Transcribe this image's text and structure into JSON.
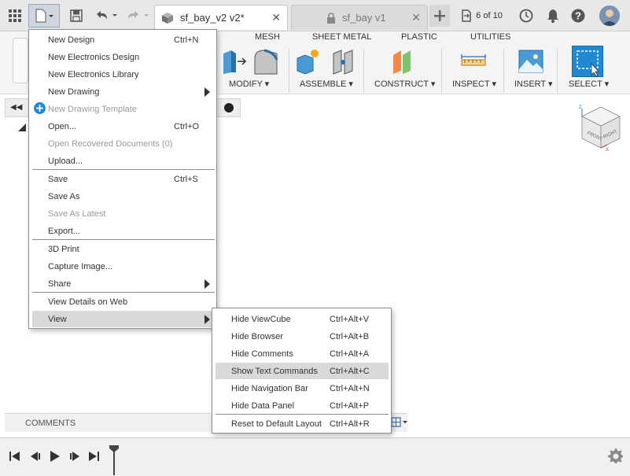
{
  "tabs": {
    "active": "sf_bay_v2 v2*",
    "inactive": "sf_bay v1"
  },
  "topbar": {
    "jobs": "6 of 10"
  },
  "ribbon": {
    "tabs": [
      "MESH",
      "SHEET METAL",
      "PLASTIC",
      "UTILITIES"
    ],
    "groups": [
      "MODIFY",
      "ASSEMBLE",
      "CONSTRUCT",
      "INSPECT",
      "INSERT",
      "SELECT"
    ]
  },
  "viewcube": {
    "front": "FRONT",
    "right": "RIGHT",
    "z": "Z",
    "x": "X"
  },
  "comments_label": "COMMENTS",
  "file_menu": [
    {
      "label": "New Design",
      "shortcut": "Ctrl+N"
    },
    {
      "label": "New Electronics Design",
      "shortcut": ""
    },
    {
      "label": "New Electronics Library",
      "shortcut": ""
    },
    {
      "label": "New Drawing",
      "shortcut": ""
    },
    {
      "label": "New Drawing Template",
      "shortcut": ""
    },
    {
      "label": "Open...",
      "shortcut": "Ctrl+O"
    },
    {
      "label": "Open Recovered Documents (0)",
      "shortcut": ""
    },
    {
      "label": "Upload...",
      "shortcut": ""
    },
    {
      "label": "Save",
      "shortcut": "Ctrl+S"
    },
    {
      "label": "Save As",
      "shortcut": ""
    },
    {
      "label": "Save As Latest",
      "shortcut": ""
    },
    {
      "label": "Export...",
      "shortcut": ""
    },
    {
      "label": "3D Print",
      "shortcut": ""
    },
    {
      "label": "Capture Image...",
      "shortcut": ""
    },
    {
      "label": "Share",
      "shortcut": ""
    },
    {
      "label": "View Details on Web",
      "shortcut": ""
    },
    {
      "label": "View",
      "shortcut": ""
    }
  ],
  "view_menu": [
    {
      "label": "Hide ViewCube",
      "shortcut": "Ctrl+Alt+V"
    },
    {
      "label": "Hide Browser",
      "shortcut": "Ctrl+Alt+B"
    },
    {
      "label": "Hide Comments",
      "shortcut": "Ctrl+Alt+A"
    },
    {
      "label": "Show Text Commands",
      "shortcut": "Ctrl+Alt+C"
    },
    {
      "label": "Hide Navigation Bar",
      "shortcut": "Ctrl+Alt+N"
    },
    {
      "label": "Hide Data Panel",
      "shortcut": "Ctrl+Alt+P"
    },
    {
      "label": "Reset to Default Layout",
      "shortcut": "Ctrl+Alt+R"
    }
  ],
  "colors": {
    "accent": "#1f8ad2",
    "menu_highlight": "#d9d9d9",
    "timeline_marker": "#444444"
  }
}
